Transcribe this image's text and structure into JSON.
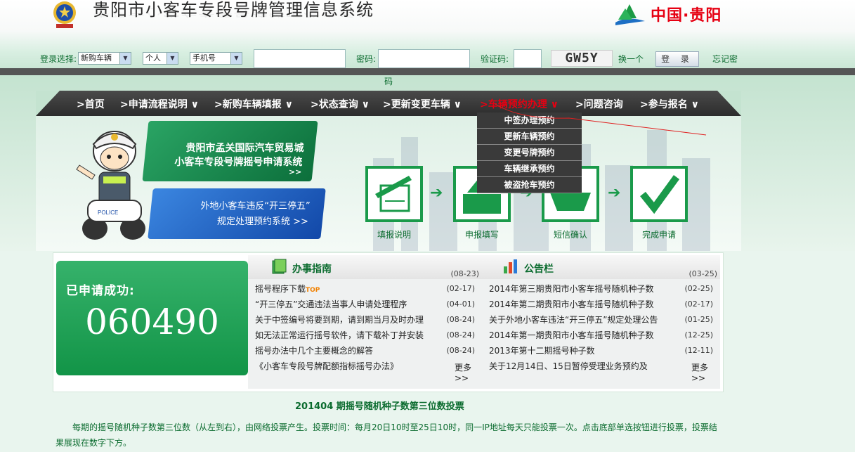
{
  "header": {
    "title": "贵阳市小客车专段号牌管理信息系统",
    "brand": "中国·贵阳"
  },
  "login": {
    "select_label": "登录选择:",
    "vehicle_type": "新购车辆",
    "person_type": "个人",
    "id_type": "手机号",
    "password_label": "密码:",
    "captcha_label": "验证码:",
    "captcha_text": "GW5Y",
    "refresh_link": "换一个",
    "login_button": "登 录",
    "forgot_link": "忘记密",
    "wrap_text": "码"
  },
  "nav": {
    "items": [
      {
        "label": ">首页"
      },
      {
        "label": ">申请流程说明 ∨"
      },
      {
        "label": ">新购车辆填报 ∨"
      },
      {
        "label": ">状态查询 ∨"
      },
      {
        "label": ">更新变更车辆 ∨"
      },
      {
        "label": ">车辆预约办理 ∨"
      },
      {
        "label": ">问题咨询"
      },
      {
        "label": ">参与报名 ∨"
      }
    ],
    "dropdown": [
      "中签办理预约",
      "更新车辆预约",
      "变更号牌预约",
      "车辆继承预约",
      "被盗抢车预约"
    ]
  },
  "banner": {
    "promo1_line1": "贵阳市孟关国际汽车贸易城",
    "promo1_line2": "小客车专段号牌摇号申请系统",
    "promo1_more": ">>",
    "promo2_line1": "外地小客车违反“开三停五”",
    "promo2_line2": "规定处理预约系统 >>",
    "steps": [
      "填报说明",
      "申报填写",
      "短信确认",
      "完成申请"
    ]
  },
  "success": {
    "title": "已申请成功:",
    "count": "060490"
  },
  "guide": {
    "title": "办事指南",
    "header_date": "(08-23)",
    "items": [
      {
        "title": "摇号程序下载",
        "date": "(02-17)",
        "badge": "TOP"
      },
      {
        "title": "“开三停五”交通违法当事人申请处理程序",
        "date": "(04-01)"
      },
      {
        "title": "关于中签编号将要到期，请到期当月及时办理",
        "date": "(08-24)"
      },
      {
        "title": "如无法正常运行摇号软件，请下载补丁并安装",
        "date": "(08-24)"
      },
      {
        "title": "摇号办法中几个主要概念的解答",
        "date": "(08-24)"
      },
      {
        "title": "《小客车专段号牌配额指标摇号办法》",
        "date": ""
      }
    ],
    "more": "更多>>"
  },
  "notice": {
    "title": "公告栏",
    "header_date": "(03-25)",
    "items": [
      {
        "title": "2014年第三期贵阳市小客车摇号随机种子数",
        "date": "(02-25)"
      },
      {
        "title": "2014年第二期贵阳市小客车摇号随机种子数",
        "date": "(02-17)"
      },
      {
        "title": "关于外地小客车违法“开三停五”规定处理公告",
        "date": "(01-25)"
      },
      {
        "title": "2014年第一期贵阳市小客车摇号随机种子数",
        "date": "(12-25)"
      },
      {
        "title": "2013年第十二期摇号种子数",
        "date": "(12-11)"
      },
      {
        "title": "关于12月14日、15日暂停受理业务预约及",
        "date": ""
      }
    ],
    "more": "更多>>"
  },
  "vote": {
    "title": "201404 期摇号随机种子数第三位数投票",
    "text": "每期的摇号随机种子数第三位数（从左到右），由网络投票产生。投票时间：每月20日10时至25日10时，同一IP地址每天只能投票一次。点击底部单选按钮进行投票，投票结果展现在数字下方。"
  },
  "colors": {
    "accent_green": "#0a6b2e",
    "nav_active": "#e60012",
    "success_green": "#1a9a4a"
  }
}
